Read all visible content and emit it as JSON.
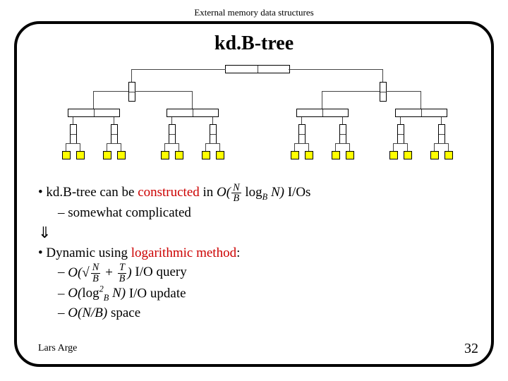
{
  "header": "External memory data structures",
  "title": "kd.B-tree",
  "bullet1": {
    "prefix": "kd.B-tree can be ",
    "hl": "constructed",
    "mid": " in ",
    "suffix": " I/Os"
  },
  "sub1": "somewhat complicated",
  "arrow": "⇓",
  "bullet2": {
    "prefix": "Dynamic using ",
    "hl": "logarithmic method",
    "suffix": ":"
  },
  "sub2a_suffix": " I/O query",
  "sub2b_suffix": " I/O update",
  "sub2c_prefix": "O",
  "sub2c_inner_num": "N",
  "sub2c_inner_den": "B",
  "sub2c_suffix": " space",
  "footer_left": "Lars Arge",
  "footer_right": "32",
  "math": {
    "O": "O",
    "N": "N",
    "B": "B",
    "T": "T",
    "log": "log",
    "two": "2"
  }
}
